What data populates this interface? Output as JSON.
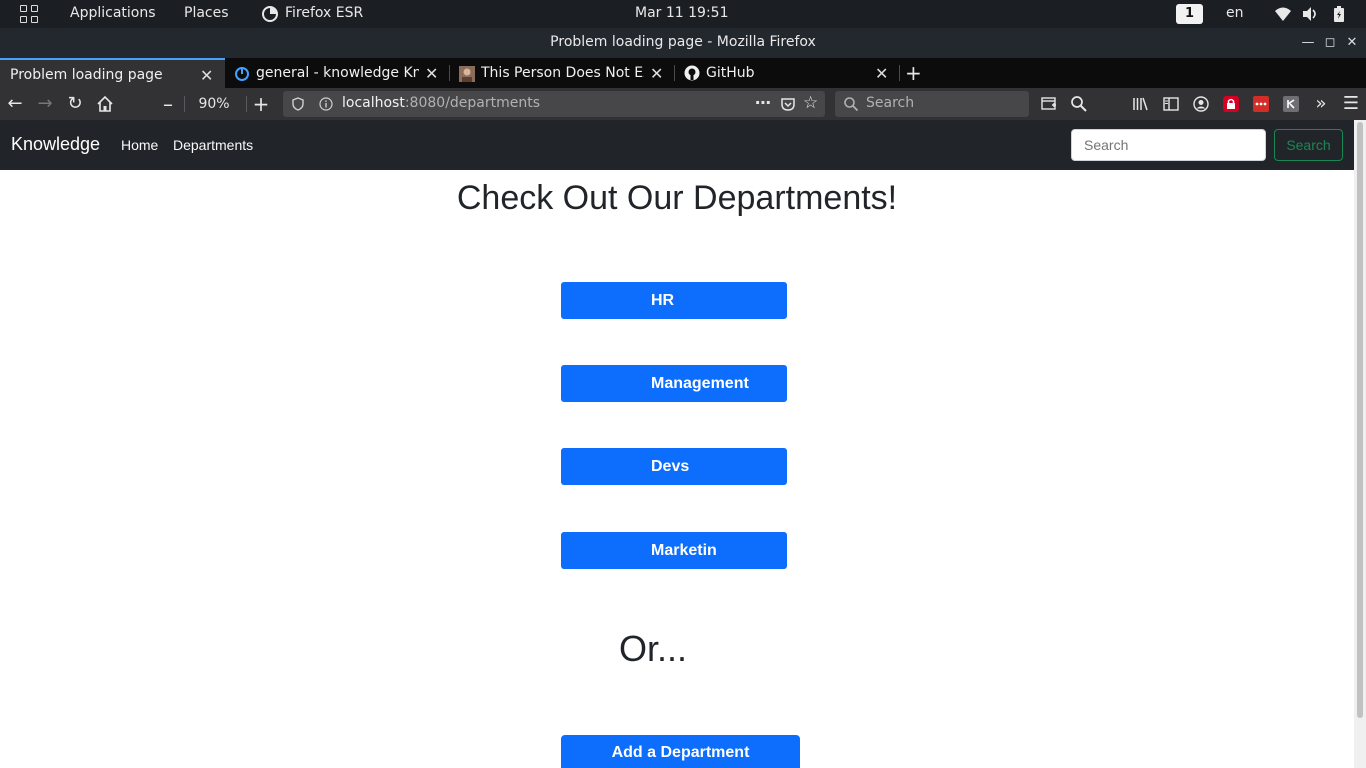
{
  "topbar": {
    "applications": "Applications",
    "places": "Places",
    "app_name": "Firefox ESR",
    "clock": "Mar 11  19:51",
    "workspace": "1",
    "language": "en"
  },
  "window": {
    "title": "Problem loading page - Mozilla Firefox"
  },
  "tabs": [
    {
      "label": "Problem loading page",
      "active": true
    },
    {
      "label": "general - knowledge Kno",
      "active": false
    },
    {
      "label": "This Person Does Not Exi",
      "active": false
    },
    {
      "label": "GitHub",
      "active": false
    }
  ],
  "navbar": {
    "zoom": "90%",
    "url_host": "localhost",
    "url_path": ":8080/departments",
    "search_placeholder": "Search"
  },
  "site": {
    "brand": "Knowledge",
    "nav": [
      "Home",
      "Departments"
    ],
    "search_placeholder": "Search",
    "search_button": "Search",
    "heading": "Check Out Our Departments!",
    "departments": [
      "HR",
      "Management",
      "Devs",
      "Marketin"
    ],
    "or_text": "Or...",
    "add_button": "Add a Department"
  },
  "colors": {
    "primary": "#0d6efd",
    "success": "#198754",
    "navbar_dark": "#212529",
    "firefox_accent": "#45a1ff"
  }
}
